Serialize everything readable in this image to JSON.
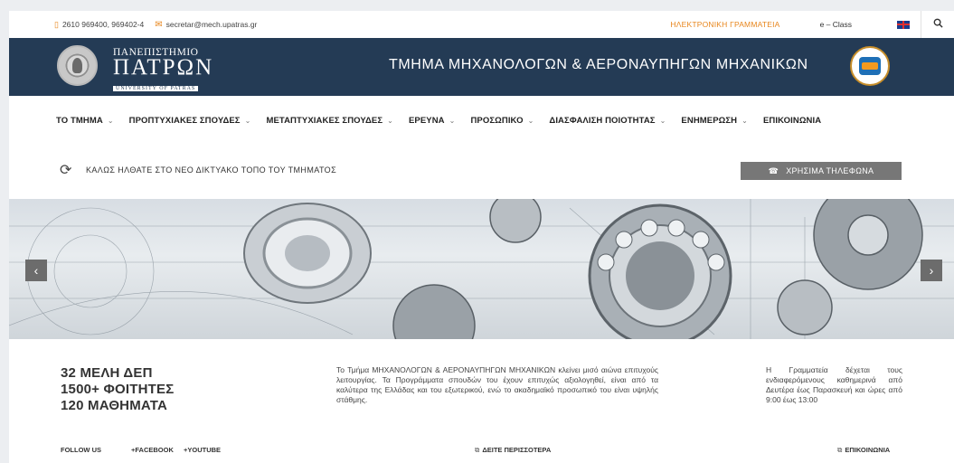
{
  "topbar": {
    "phone": "2610 969400, 969402-4",
    "email": "secretar@mech.upatras.gr",
    "secretariat_link": "ΗΛΕΚΤΡΟΝΙΚΗ ΓΡΑΜΜΑΤΕΙΑ",
    "eclass_link": "e – Class",
    "phone_icon": "phone-icon",
    "mail_icon": "mail-icon",
    "flag_icon": "uk-flag-icon",
    "search_icon": "search-icon",
    "accent_color": "#e8861c"
  },
  "header": {
    "uni_line1": "ΠΑΝΕΠΙΣΤΗΜΙΟ",
    "uni_line2": "ΠΑΤΡΩΝ",
    "uni_line3": "UNIVERSITY OF PATRAS",
    "department": "ΤΜΗΜΑ ΜΗΧΑΝΟΛΟΓΩΝ & ΑΕΡΟΝΑΥΠΗΓΩΝ ΜΗΧΑΝΙΚΩΝ",
    "background_color": "#243b55"
  },
  "nav": {
    "items": [
      {
        "label": "ΤΟ ΤΜΗΜΑ",
        "has_dropdown": true
      },
      {
        "label": "ΠΡΟΠΤΥΧΙΑΚΕΣ ΣΠΟΥΔΕΣ",
        "has_dropdown": true
      },
      {
        "label": "ΜΕΤΑΠΤΥΧΙΑΚΕΣ ΣΠΟΥΔΕΣ",
        "has_dropdown": true
      },
      {
        "label": "ΕΡΕΥΝΑ",
        "has_dropdown": true
      },
      {
        "label": "ΠΡΟΣΩΠΙΚΟ",
        "has_dropdown": true
      },
      {
        "label": "ΔΙΑΣΦΑΛΙΣΗ ΠΟΙΟΤΗΤΑΣ",
        "has_dropdown": true
      },
      {
        "label": "ΕΝΗΜΕΡΩΣΗ",
        "has_dropdown": true
      },
      {
        "label": "ΕΠΙΚΟΙΝΩΝΙΑ",
        "has_dropdown": false
      }
    ],
    "chevron": "⌄"
  },
  "welcome": {
    "text": "ΚΑΛΩΣ ΗΛΘΑΤΕ ΣΤΟ ΝΕΟ ΔΙΚΤΥΑΚΟ ΤΟΠΟ ΤΟΥ ΤΜΗΜΑΤΟΣ",
    "phones_button": "ΧΡΗΣΙΜΑ ΤΗΛΕΦΩΝΑ",
    "sync_icon": "sync-icon"
  },
  "slider": {
    "prev": "‹",
    "next": "›"
  },
  "info": {
    "stats": [
      "32 ΜΕΛΗ ΔΕΠ",
      "1500+ ΦΟΙΤΗΤΕΣ",
      "120 ΜΑΘΗΜΑΤΑ"
    ],
    "description": "Το Τμήμα ΜΗΧΑΝΟΛΟΓΩΝ & ΑΕΡΟΝΑΥΠΗΓΩΝ ΜΗΧΑΝΙΚΩΝ κλείνει μισό αιώνα επιτυχούς λειτουργίας. Τα Προγράμματα σπουδών του έχουν επιτυχώς αξιολογηθεί, είναι από τα καλύτερα της Ελλάδας και του εξωτερικού, ενώ το ακαδημαϊκό προσωπικό του είναι υψηλής στάθμης.",
    "hours": "Η Γραμματεία δέχεται τους ενδιαφερόμενους καθημερινά από Δευτέρα έως Παρασκευή και ώρες από 9:00 έως 13:00"
  },
  "footer": {
    "follow_us": "FOLLOW US",
    "facebook": "+FACEBOOK",
    "youtube": "+YOUTUBE",
    "see_more": "ΔΕΙΤΕ ΠΕΡΙΣΣΟΤΕΡΑ",
    "contact": "ΕΠΙΚΟΙΝΩΝΙΑ",
    "external_icon": "external-link-icon"
  }
}
